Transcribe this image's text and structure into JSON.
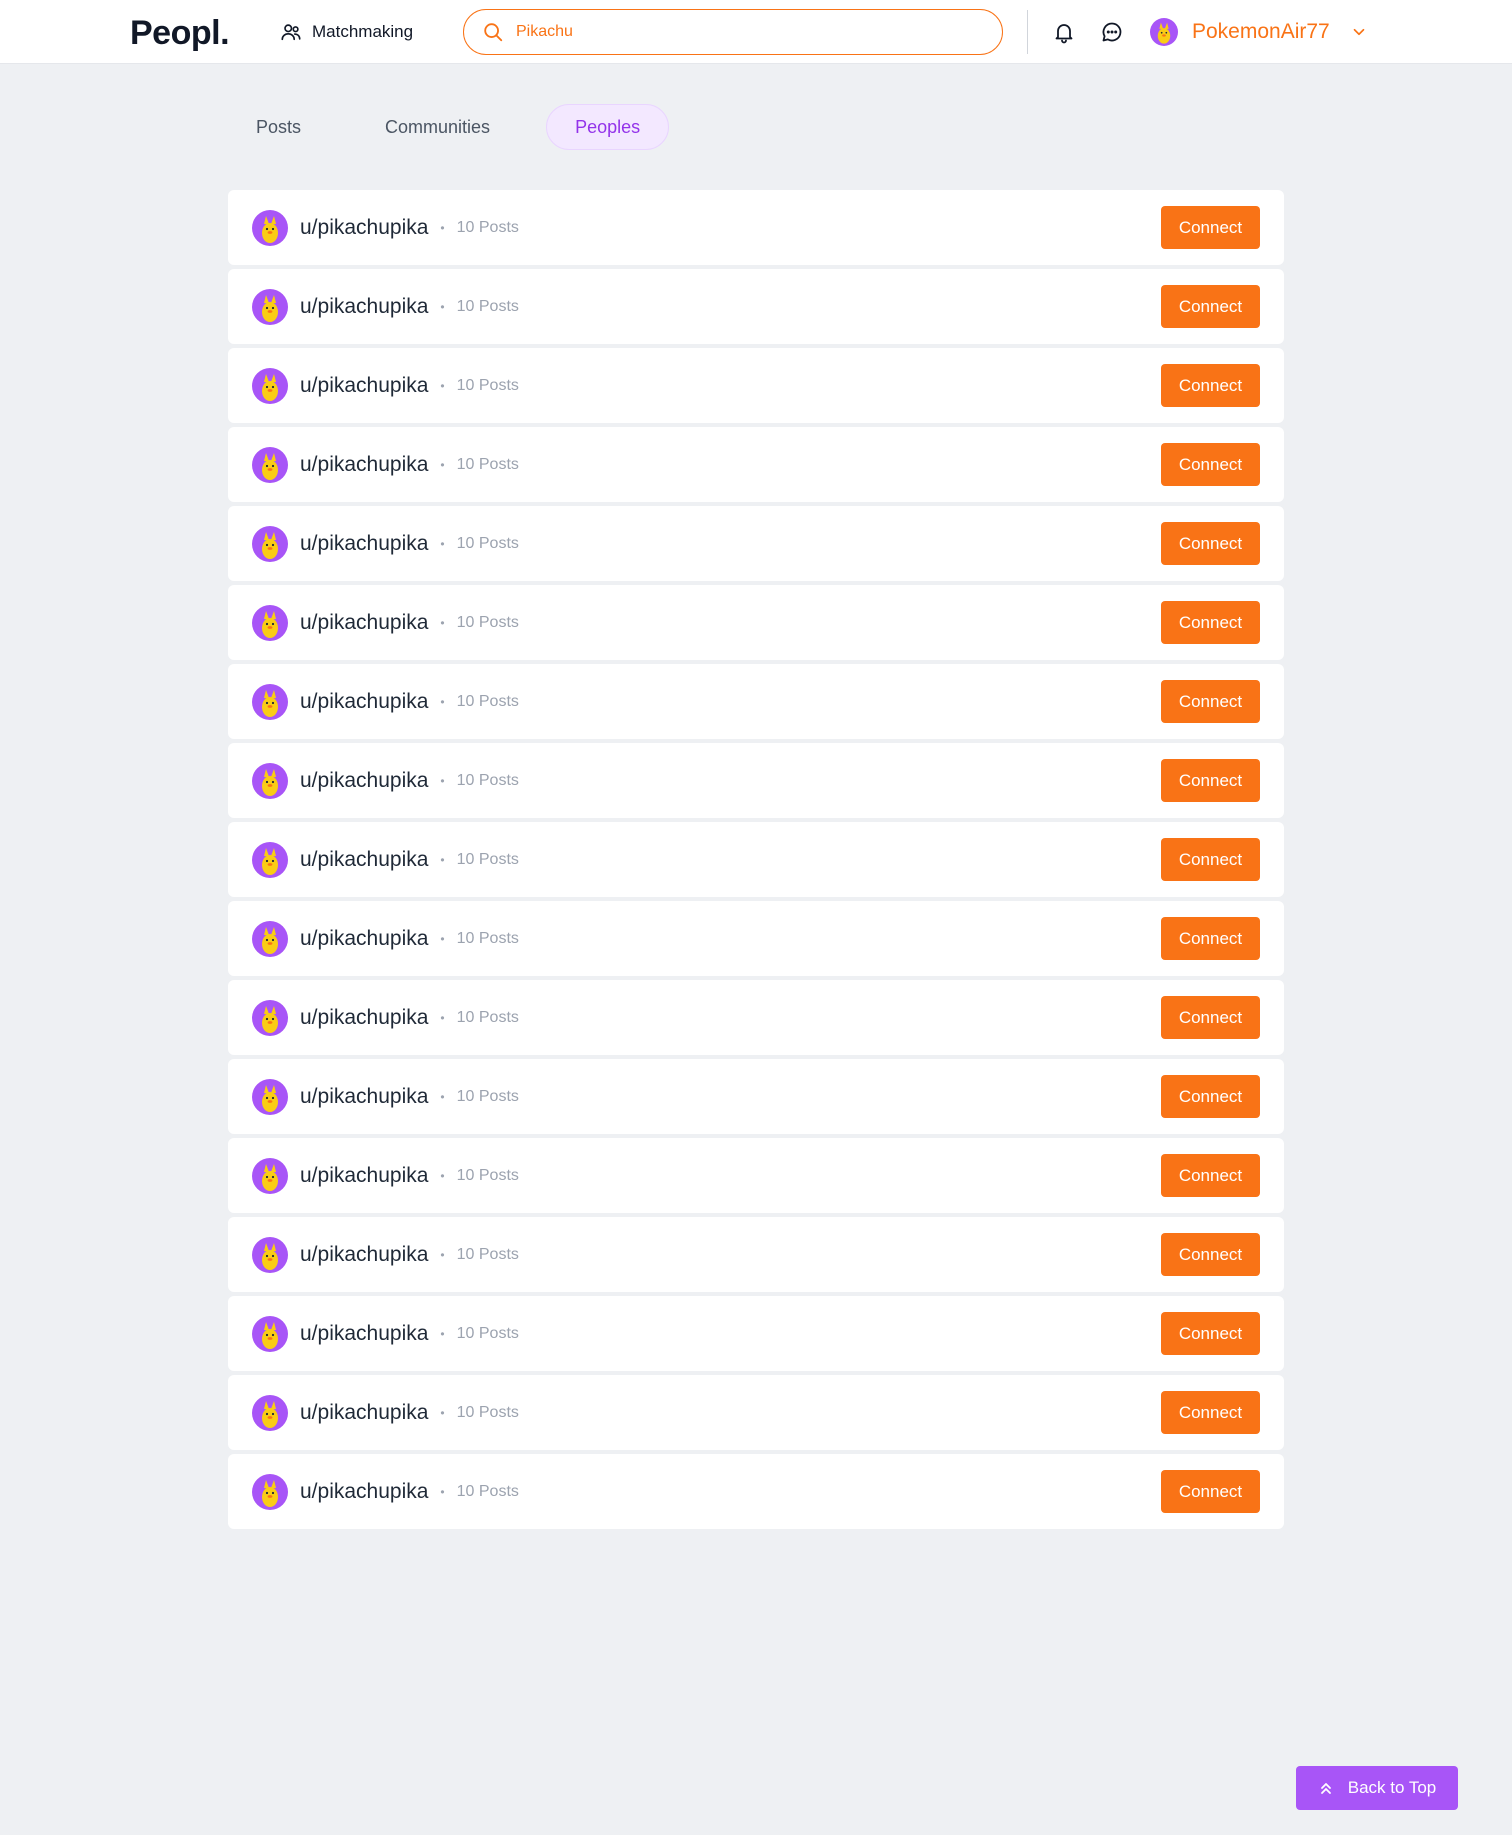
{
  "header": {
    "logo": "Peopl.",
    "matchmaking_label": "Matchmaking",
    "search_value": "Pikachu",
    "username": "PokemonAir77"
  },
  "tabs": [
    {
      "label": "Posts",
      "active": false
    },
    {
      "label": "Communities",
      "active": false
    },
    {
      "label": "Peoples",
      "active": true
    }
  ],
  "people": [
    {
      "username": "u/pikachupika",
      "posts": "10 Posts",
      "action": "Connect"
    },
    {
      "username": "u/pikachupika",
      "posts": "10 Posts",
      "action": "Connect"
    },
    {
      "username": "u/pikachupika",
      "posts": "10 Posts",
      "action": "Connect"
    },
    {
      "username": "u/pikachupika",
      "posts": "10 Posts",
      "action": "Connect"
    },
    {
      "username": "u/pikachupika",
      "posts": "10 Posts",
      "action": "Connect"
    },
    {
      "username": "u/pikachupika",
      "posts": "10 Posts",
      "action": "Connect"
    },
    {
      "username": "u/pikachupika",
      "posts": "10 Posts",
      "action": "Connect"
    },
    {
      "username": "u/pikachupika",
      "posts": "10 Posts",
      "action": "Connect"
    },
    {
      "username": "u/pikachupika",
      "posts": "10 Posts",
      "action": "Connect"
    },
    {
      "username": "u/pikachupika",
      "posts": "10 Posts",
      "action": "Connect"
    },
    {
      "username": "u/pikachupika",
      "posts": "10 Posts",
      "action": "Connect"
    },
    {
      "username": "u/pikachupika",
      "posts": "10 Posts",
      "action": "Connect"
    },
    {
      "username": "u/pikachupika",
      "posts": "10 Posts",
      "action": "Connect"
    },
    {
      "username": "u/pikachupika",
      "posts": "10 Posts",
      "action": "Connect"
    },
    {
      "username": "u/pikachupika",
      "posts": "10 Posts",
      "action": "Connect"
    },
    {
      "username": "u/pikachupika",
      "posts": "10 Posts",
      "action": "Connect"
    },
    {
      "username": "u/pikachupika",
      "posts": "10 Posts",
      "action": "Connect"
    }
  ],
  "back_to_top": "Back to Top",
  "icons": {
    "matchmaking": "users-icon",
    "search": "search-icon",
    "notifications": "bell-icon",
    "messages": "chat-icon",
    "dropdown": "chevron-down-icon",
    "back_to_top": "double-chevron-up-icon"
  },
  "colors": {
    "accent": "#f97316",
    "purple": "#a855f7",
    "background": "#eef0f3"
  }
}
